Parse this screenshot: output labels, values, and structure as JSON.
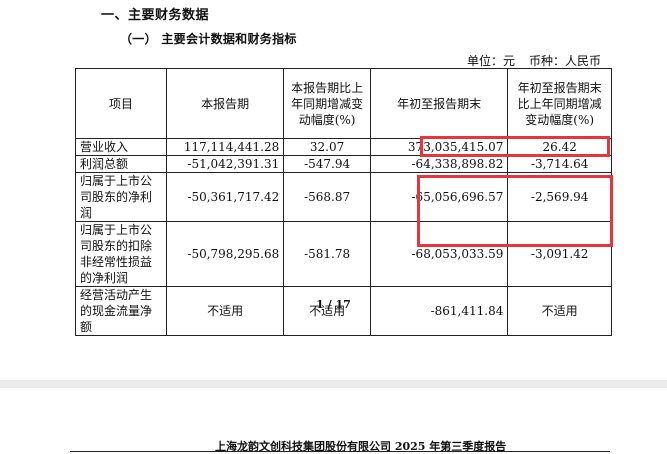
{
  "doc": {
    "section_title": "一、主要财务数据",
    "subsection_title": "（一）  主要会计数据和财务指标",
    "unit_label": "单位：元",
    "currency_label": "币种：人民币",
    "page_number": "1 / 17",
    "footer": "上海龙韵文创科技集团股份有限公司  2025 年第三季度报告"
  },
  "table": {
    "headers": [
      "项目",
      "本报告期",
      "本报告期比上年同期增减变动幅度(%)",
      "年初至报告期末",
      "年初至报告期末比上年同期增减变动幅度(%)"
    ],
    "rows": [
      [
        "营业收入",
        "117,114,441.28",
        "32.07",
        "373,035,415.07",
        "26.42"
      ],
      [
        "利润总额",
        "-51,042,391.31",
        "-547.94",
        "-64,338,898.82",
        "-3,714.64"
      ],
      [
        "归属于上市公司股东的净利润",
        "-50,361,717.42",
        "-568.87",
        "-65,056,696.57",
        "-2,569.94"
      ],
      [
        "归属于上市公司股东的扣除非经常性损益的净利润",
        "-50,798,295.68",
        "-581.78",
        "-68,053,033.59",
        "-3,091.42"
      ],
      [
        "经营活动产生的现金流量净额",
        "不适用",
        "不适用",
        "-861,411.84",
        "不适用"
      ]
    ]
  },
  "colors": {
    "highlight_border": "#e8353b",
    "page_gap": "#ececec"
  }
}
